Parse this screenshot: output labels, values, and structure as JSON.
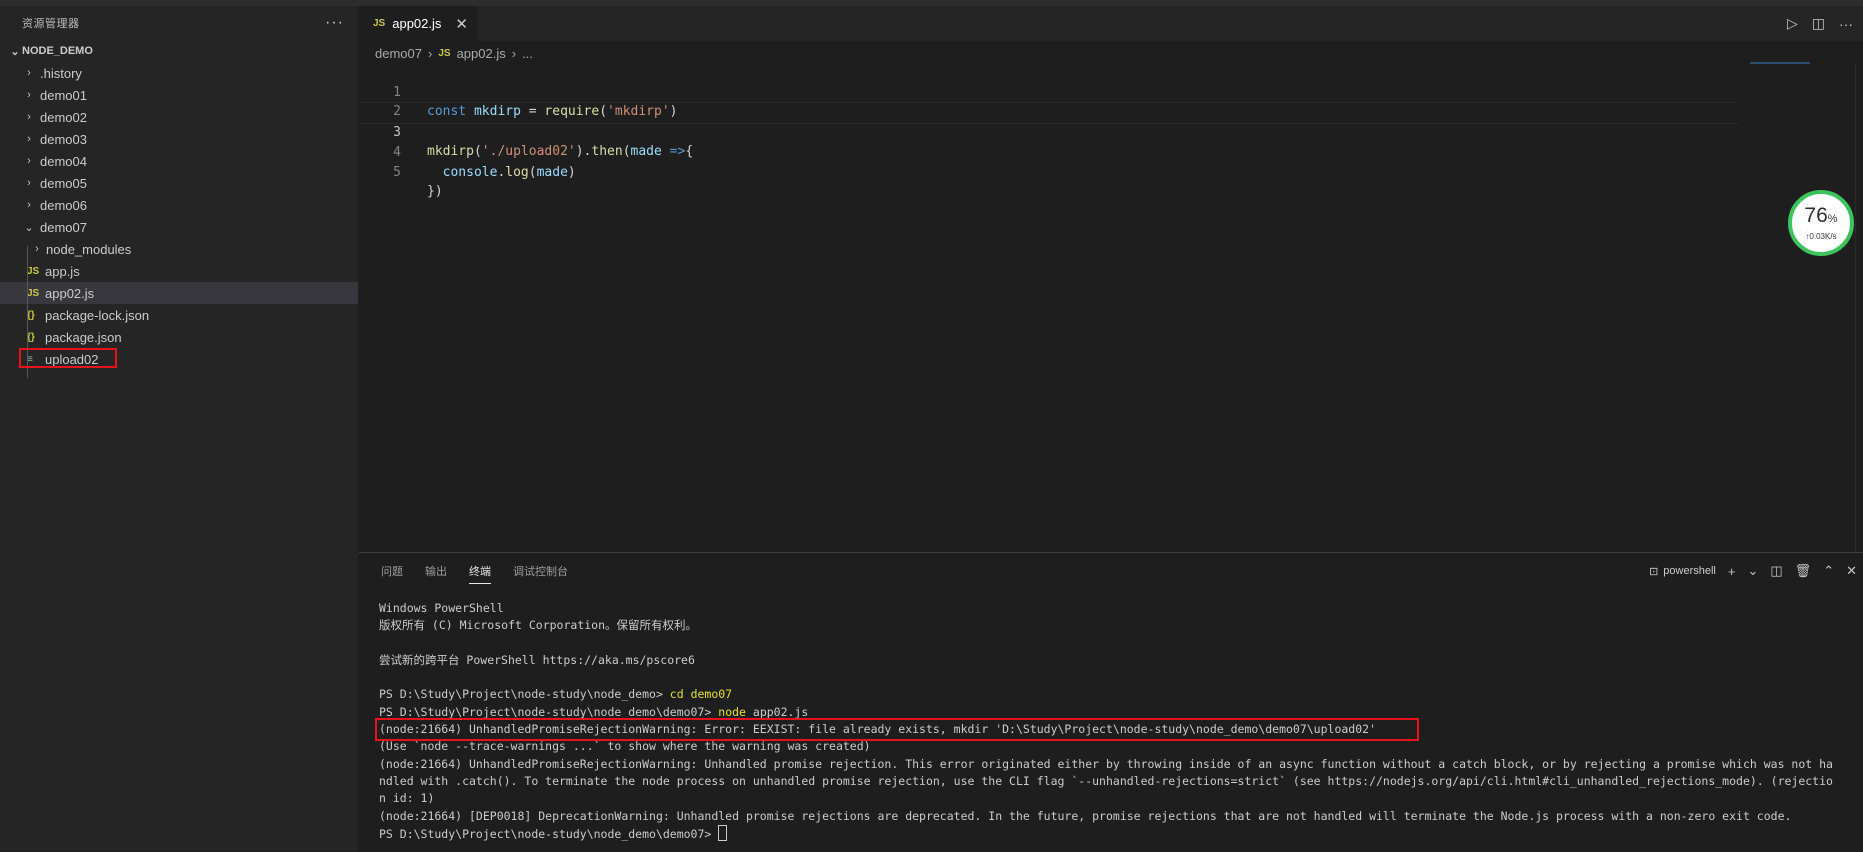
{
  "explorer": {
    "title": "资源管理器",
    "more": "···",
    "project": "NODE_DEMO",
    "items": [
      {
        "label": ".history"
      },
      {
        "label": "demo01"
      },
      {
        "label": "demo02"
      },
      {
        "label": "demo03"
      },
      {
        "label": "demo04"
      },
      {
        "label": "demo05"
      },
      {
        "label": "demo06"
      },
      {
        "label": "demo07"
      }
    ],
    "children": [
      {
        "label": "node_modules",
        "icon": ""
      },
      {
        "label": "app.js",
        "icon": "JS"
      },
      {
        "label": "app02.js",
        "icon": "JS"
      },
      {
        "label": "package-lock.json",
        "icon": "{}"
      },
      {
        "label": "package.json",
        "icon": "{}"
      },
      {
        "label": "upload02",
        "icon": "≡"
      }
    ]
  },
  "editor": {
    "tab_icon": "JS",
    "tab_label": "app02.js",
    "tab_close": "✕",
    "breadcrumb": {
      "folder": "demo07",
      "sep1": "›",
      "icon": "JS",
      "file": "app02.js",
      "sep2": "›",
      "tail": "..."
    },
    "line_numbers": [
      "1",
      "2",
      "3",
      "4",
      "5"
    ]
  },
  "netmon": {
    "percent": "76",
    "unit": "%",
    "speed": "↑0.03K/s"
  },
  "panel": {
    "tabs": [
      "问题",
      "输出",
      "终端",
      "调试控制台"
    ],
    "shell": "powershell",
    "terminal_lines": [
      "Windows PowerShell",
      "版权所有 (C) Microsoft Corporation。保留所有权利。",
      "",
      "尝试新的跨平台 PowerShell https://aka.ms/pscore6",
      "",
      "PS D:\\Study\\Project\\node-study\\node_demo> ",
      "PS D:\\Study\\Project\\node-study\\node_demo\\demo07> ",
      "(node:21664) UnhandledPromiseRejectionWarning: Error: EEXIST: file already exists, mkdir 'D:\\Study\\Project\\node-study\\node_demo\\demo07\\upload02'",
      "(Use `node --trace-warnings ...` to show where the warning was created)",
      "(node:21664) UnhandledPromiseRejectionWarning: Unhandled promise rejection. This error originated either by throwing inside of an async function without a catch block, or by rejecting a promise which was not ha",
      "ndled with .catch(). To terminate the node process on unhandled promise rejection, use the CLI flag `--unhandled-rejections=strict` (see https://nodejs.org/api/cli.html#cli_unhandled_rejections_mode). (rejectio",
      "n id: 1)",
      "(node:21664) [DEP0018] DeprecationWarning: Unhandled promise rejections are deprecated. In the future, promise rejections that are not handled will terminate the Node.js process with a non-zero exit code.",
      "PS D:\\Study\\Project\\node-study\\node_demo\\demo07> "
    ],
    "cmd1": "cd demo07",
    "cmd2": "node",
    "cmd2_arg": " app02.js"
  }
}
